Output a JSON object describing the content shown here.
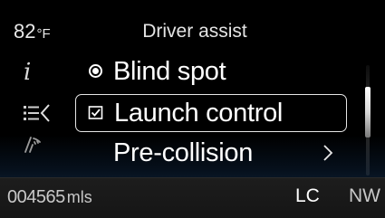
{
  "header": {
    "temperature_value": "82",
    "temperature_unit": "°F",
    "title": "Driver assist"
  },
  "side_icons": {
    "info": "info-icon",
    "menu": "list-menu-icon",
    "wiper": "wiper-icon"
  },
  "menu": {
    "items": [
      {
        "label": "Blind spot",
        "glyph": "radio-selected-icon",
        "selected": true
      },
      {
        "label": "Launch control",
        "glyph": "checkbox-checked-icon",
        "focused": true,
        "checked": true
      },
      {
        "label": "Pre-collision",
        "glyph": "chevron-right-icon",
        "has_submenu": true
      }
    ],
    "scroll_position": 0.2
  },
  "status_bar": {
    "odometer_value": "004565",
    "odometer_unit": "mls",
    "indicator": "LC",
    "compass": "NW"
  },
  "colors": {
    "background": "#000000",
    "glow_blue": "#163455",
    "text": "#ffffff",
    "muted_text": "#c8c8c8"
  }
}
